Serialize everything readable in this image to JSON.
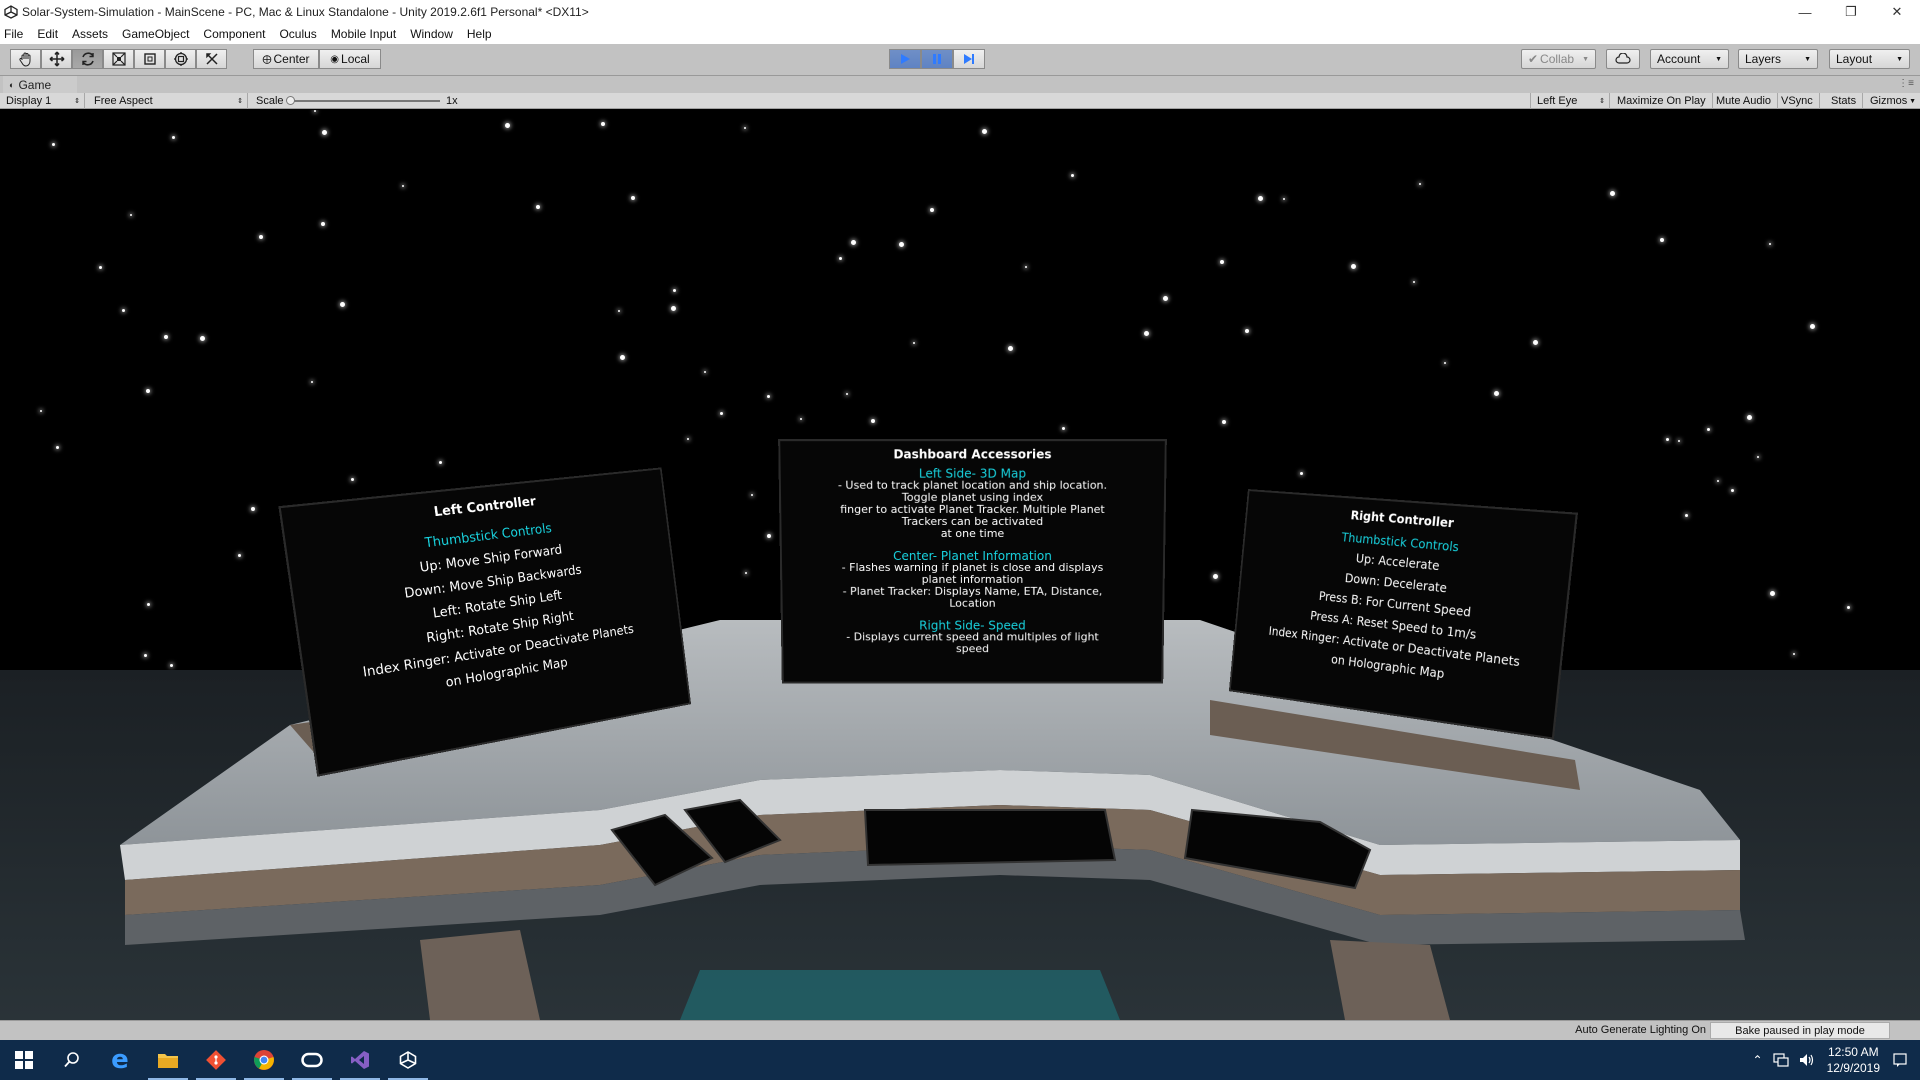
{
  "window": {
    "title": "Solar-System-Simulation - MainScene - PC, Mac & Linux Standalone - Unity 2019.2.6f1 Personal* <DX11>",
    "minimize_icon": "minimize-icon",
    "restore_icon": "restore-icon",
    "close_icon": "close-icon"
  },
  "menu": [
    "File",
    "Edit",
    "Assets",
    "GameObject",
    "Component",
    "Oculus",
    "Mobile Input",
    "Window",
    "Help"
  ],
  "toolbar": {
    "tools": [
      "hand-tool-icon",
      "move-tool-icon",
      "rotate-tool-icon",
      "scale-tool-icon",
      "rect-tool-icon",
      "transform-tool-icon",
      "custom-tool-icon"
    ],
    "pivot_center": "Center",
    "pivot_local": "Local",
    "collab": "Collab",
    "account": "Account",
    "layers": "Layers",
    "layout": "Layout"
  },
  "game_tab": {
    "label": "Game"
  },
  "game_bar": {
    "display": "Display 1",
    "aspect": "Free Aspect",
    "scale_label": "Scale",
    "scale_value": "1x",
    "eye": "Left Eye",
    "maximize": "Maximize On Play",
    "mute": "Mute Audio",
    "vsync": "VSync",
    "stats": "Stats",
    "gizmos": "Gizmos"
  },
  "scene": {
    "left_panel": {
      "title": "Left Controller",
      "subtitle": "Thumbstick Controls",
      "lines": [
        "Up: Move Ship Forward",
        "Down: Move Ship Backwards",
        "Left: Rotate Ship Left",
        "Right: Rotate Ship Right",
        "Index Ringer: Activate or Deactivate Planets",
        "on Holographic Map"
      ]
    },
    "center_panel": {
      "title": "Dashboard Accessories",
      "section1": "Left Side- 3D Map",
      "section1_lines": [
        "- Used to track planet location and ship location.",
        "Toggle planet using index",
        "finger to activate Planet Tracker. Multiple Planet",
        "Trackers can be activated",
        "at one time"
      ],
      "section2": "Center- Planet Information",
      "section2_lines": [
        "- Flashes warning if planet is close and displays",
        "planet information",
        "- Planet Tracker: Displays Name, ETA, Distance,",
        "Location"
      ],
      "section3": "Right Side- Speed",
      "section3_lines": [
        "- Displays current speed and multiples of light",
        "speed"
      ]
    },
    "right_panel": {
      "title": "Right Controller",
      "subtitle": "Thumbstick Controls",
      "lines": [
        "Up: Accelerate",
        "Down: Decelerate",
        "Press B: For Current Speed",
        "Press A: Reset Speed to 1m/s",
        "Index Ringer: Activate or Deactivate Planets",
        "on Holographic Map"
      ]
    }
  },
  "status_bar": {
    "auto_lighting": "Auto Generate Lighting On",
    "bake": "Bake paused in play mode"
  },
  "taskbar": {
    "apps": [
      "windows-start-icon",
      "search-icon",
      "edge-icon",
      "file-explorer-icon",
      "git-icon",
      "chrome-icon",
      "oculus-icon",
      "visual-studio-icon",
      "unity-icon"
    ],
    "time": "12:50 AM",
    "date": "12/9/2019"
  },
  "colors": {
    "accent_cyan": "#19d3df",
    "play_active": "#5f83c3",
    "taskbar": "#0f2b4a"
  }
}
